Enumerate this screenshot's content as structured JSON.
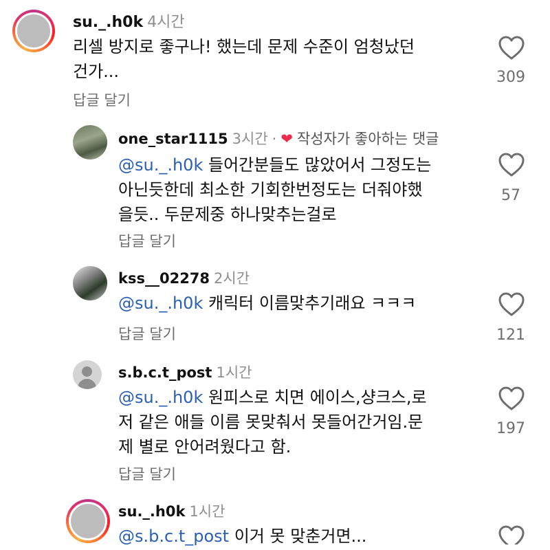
{
  "comments": [
    {
      "username": "su._.h0k",
      "time": "4시간",
      "mention": "",
      "text_lines": [
        "리셀 방지로 좋구나! 했는데 문제 수준이 엄청났던",
        "건가..."
      ],
      "reply_label": "답글 달기",
      "likes": "309"
    },
    {
      "username": "one_star1115",
      "time": "3시간",
      "author_liked": "작성자가 좋아하는 댓글",
      "mention": "@su._.h0k",
      "text_lines": [
        "들어간분들도 많았어서 그정도는",
        "아닌듯한데 최소한 기회한번정도는 더줘야했",
        "을듯.. 두문제중 하나맞추는걸로"
      ],
      "reply_label": "답글 달기",
      "likes": "57"
    },
    {
      "username": "kss__02278",
      "time": "2시간",
      "mention": "@su._.h0k",
      "text_lines": [
        "캐릭터 이름맞추기래요 ㅋㅋㅋ"
      ],
      "reply_label": "답글 달기",
      "likes": "121"
    },
    {
      "username": "s.b.c.t_post",
      "time": "1시간",
      "mention": "@su._.h0k",
      "text_lines": [
        "원피스로 치면 에이스,샹크스,로",
        "저 같은 애들 이름 못맞춰서 못들어간거임.문",
        "제 별로 안어려웠다고 함."
      ],
      "reply_label": "답글 달기",
      "likes": "197"
    },
    {
      "username": "su._.h0k",
      "time": "1시간",
      "mention": "@s.b.c.t_post",
      "text_lines": [
        "이거 못 맞춘거면..."
      ],
      "reply_label": "",
      "likes": ""
    }
  ],
  "icons": {
    "like": "heart-outline-icon",
    "author_like": "heart-filled-icon"
  },
  "colors": {
    "mention": "#2a5fb4",
    "author_heart": "#ed2c4d",
    "story_ring": "#e1306c"
  }
}
